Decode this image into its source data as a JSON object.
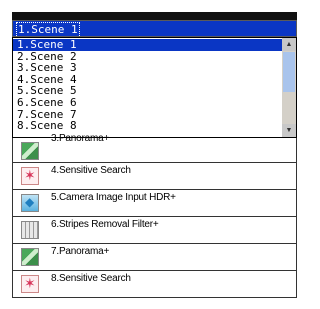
{
  "combo": {
    "selected": "1.Scene 1"
  },
  "dropdown": {
    "options": [
      "1.Scene 1",
      "2.Scene 2",
      "3.Scene 3",
      "4.Scene 4",
      "5.Scene 5",
      "6.Scene 6",
      "7.Scene 7",
      "8.Scene 8"
    ],
    "selected_index": 0
  },
  "items": [
    {
      "label": "3.Panorama+",
      "icon": "panorama-icon"
    },
    {
      "label": "4.Sensitive Search",
      "icon": "sensitive-search-icon"
    },
    {
      "label": "5.Camera Image Input HDR+",
      "icon": "camera-image-icon"
    },
    {
      "label": "6.Stripes Removal Filter+",
      "icon": "stripes-filter-icon"
    },
    {
      "label": "7.Panorama+",
      "icon": "panorama-icon"
    },
    {
      "label": "8.Sensitive Search",
      "icon": "sensitive-search-icon"
    }
  ]
}
